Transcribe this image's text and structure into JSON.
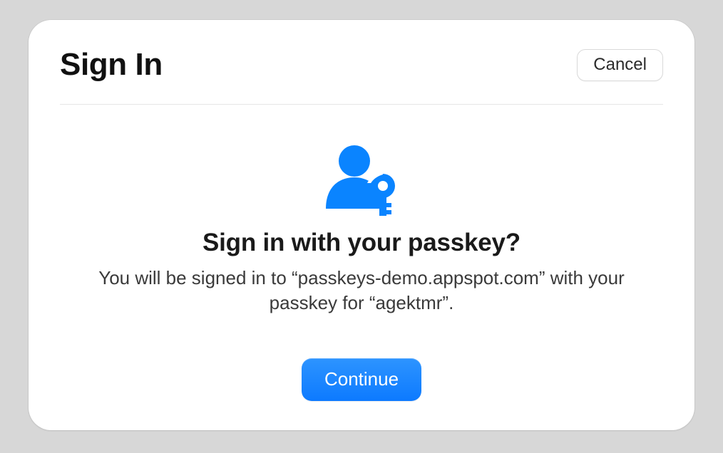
{
  "dialog": {
    "title": "Sign In",
    "cancel_label": "Cancel",
    "prompt_heading": "Sign in with your passkey?",
    "prompt_sub": "You will be signed in to “passkeys-demo.appspot.com” with your passkey for “agektmr”.",
    "continue_label": "Continue",
    "icon": "passkey-icon",
    "accent_color": "#0a84ff"
  }
}
